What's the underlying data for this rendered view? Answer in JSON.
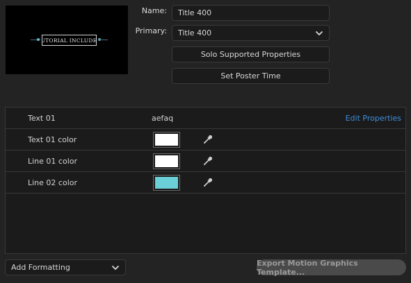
{
  "thumbnail": {
    "title_text": "TUTORIAL INCLUDED"
  },
  "name": {
    "label": "Name:",
    "value": "Title 400"
  },
  "primary": {
    "label": "Primary:",
    "value": "Title 400"
  },
  "buttons": {
    "solo": "Solo Supported Properties",
    "poster": "Set Poster Time"
  },
  "properties": {
    "header": {
      "name": "Text 01",
      "value": "aefaq",
      "edit_link": "Edit Properties"
    },
    "rows": [
      {
        "name": "Text 01 color",
        "color": "#ffffff"
      },
      {
        "name": "Line 01 color",
        "color": "#ffffff"
      },
      {
        "name": "Line 02 color",
        "color": "#6bcfd8"
      }
    ]
  },
  "footer": {
    "add_formatting": "Add Formatting",
    "export": "Export Motion Graphics Template..."
  },
  "icons": {
    "eyedropper": "eyedropper-icon",
    "dropdown": "chevron-down-icon"
  }
}
